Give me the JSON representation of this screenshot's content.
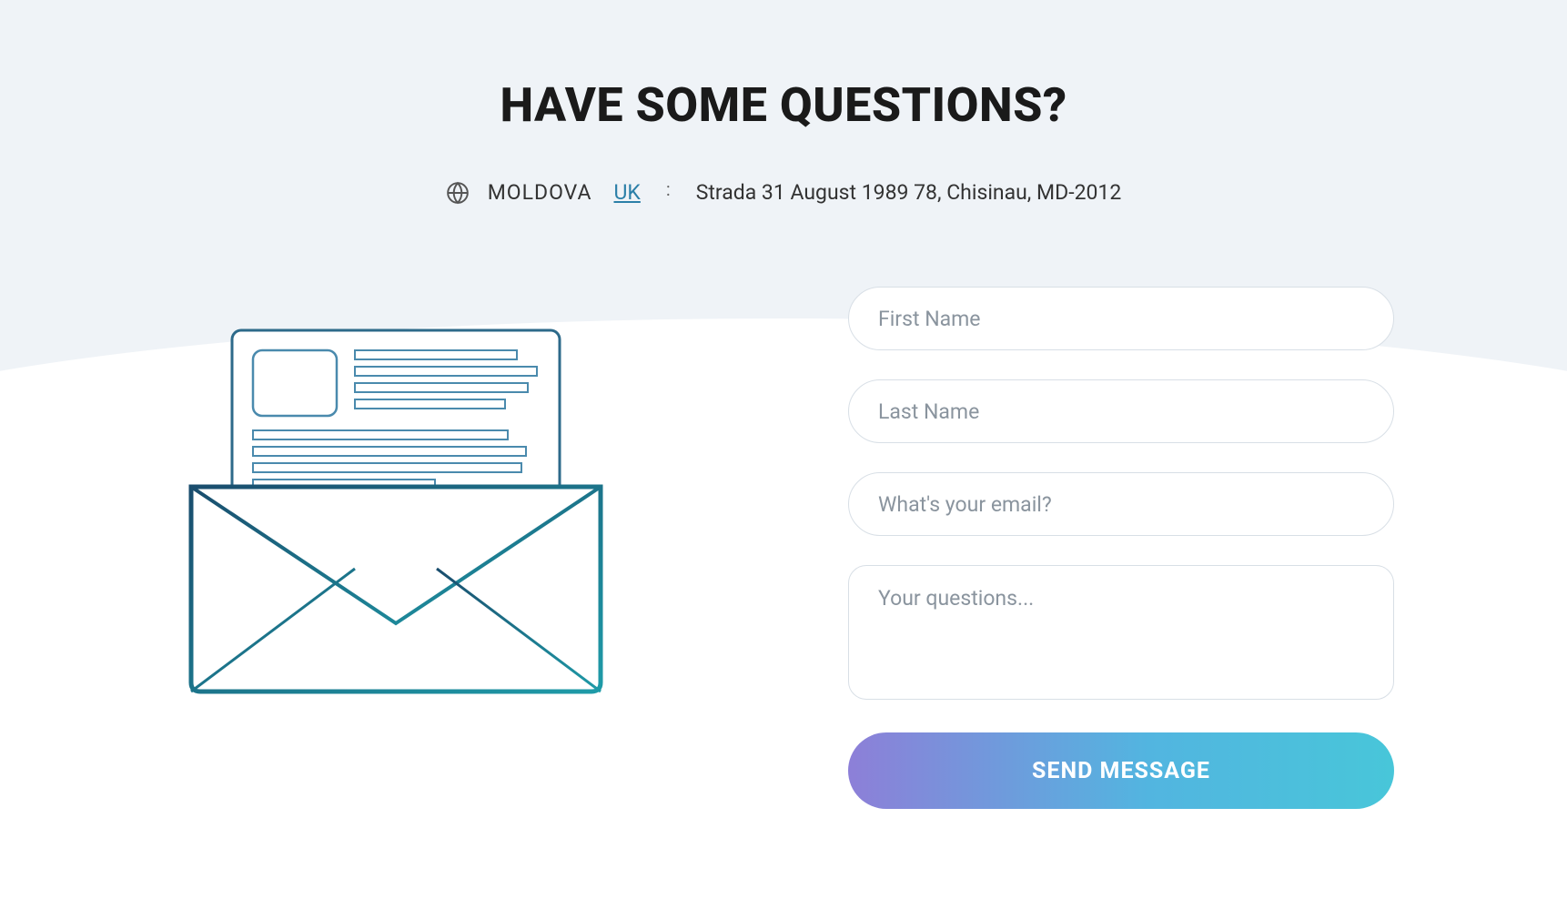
{
  "heading": "HAVE SOME QUESTIONS?",
  "location": {
    "active_country": "MOLDOVA",
    "other_country": "UK",
    "separator": ":",
    "address": "Strada 31 August 1989 78, Chisinau, MD-2012"
  },
  "form": {
    "first_name_placeholder": "First Name",
    "last_name_placeholder": "Last Name",
    "email_placeholder": "What's your email?",
    "questions_placeholder": "Your questions...",
    "submit_label": "SEND MESSAGE"
  }
}
